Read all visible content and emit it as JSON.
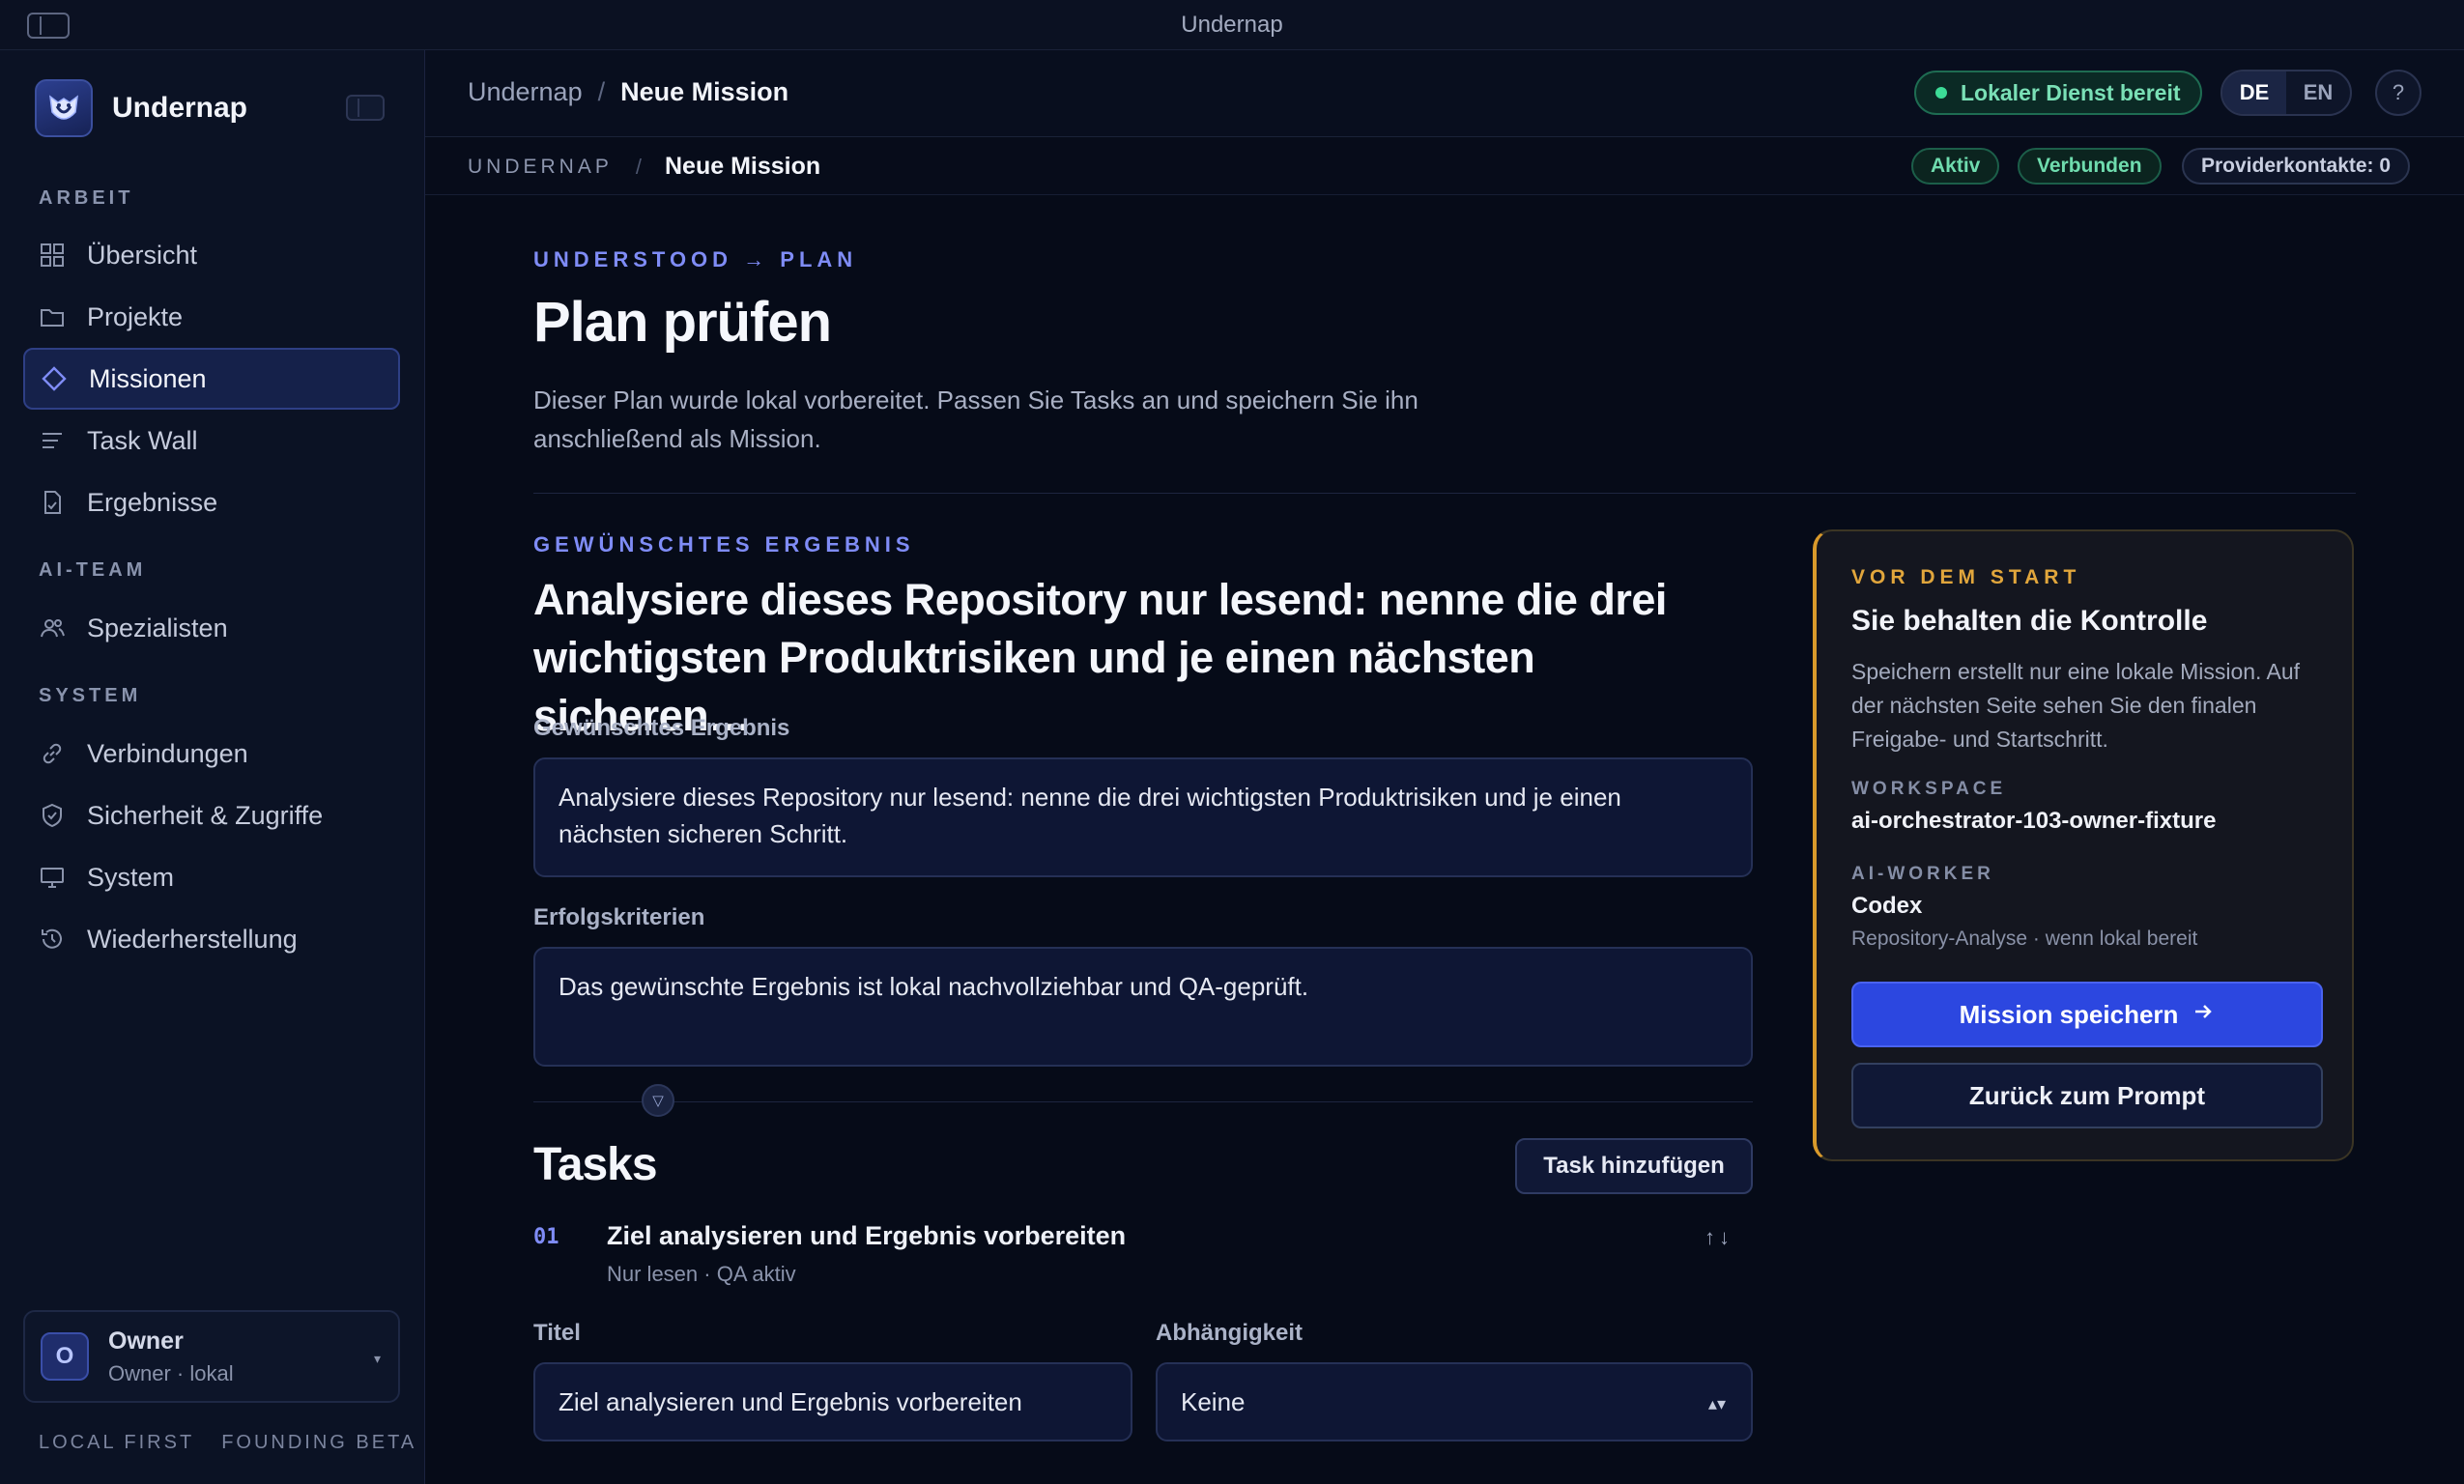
{
  "window": {
    "title": "Undernap"
  },
  "sidebar": {
    "brand": "Undernap",
    "sections": [
      {
        "label": "ARBEIT"
      },
      {
        "label": "AI-TEAM"
      },
      {
        "label": "SYSTEM"
      }
    ],
    "items": [
      {
        "label": "Übersicht",
        "icon": "grid-icon"
      },
      {
        "label": "Projekte",
        "icon": "folder-icon"
      },
      {
        "label": "Missionen",
        "icon": "diamond-icon",
        "active": true
      },
      {
        "label": "Task Wall",
        "icon": "lines-icon"
      },
      {
        "label": "Ergebnisse",
        "icon": "document-icon"
      },
      {
        "label": "Spezialisten",
        "icon": "users-icon"
      },
      {
        "label": "Verbindungen",
        "icon": "link-icon"
      },
      {
        "label": "Sicherheit & Zugriffe",
        "icon": "shield-icon"
      },
      {
        "label": "System",
        "icon": "monitor-icon"
      },
      {
        "label": "Wiederherstellung",
        "icon": "history-icon"
      }
    ],
    "owner": {
      "initial": "O",
      "name": "Owner",
      "sub": "Owner · lokal"
    },
    "footer": [
      "LOCAL FIRST",
      "FOUNDING BETA"
    ]
  },
  "header": {
    "crumb_root": "Undernap",
    "crumb_sep": "/",
    "crumb_current": "Neue Mission",
    "status": "Lokaler Dienst bereit",
    "lang": [
      "DE",
      "EN"
    ],
    "lang_active": "DE",
    "help": "?"
  },
  "subheader": {
    "crumb_root": "UNDERNAP",
    "crumb_sep": "/",
    "crumb_current": "Neue Mission",
    "badges": [
      "Aktiv",
      "Verbunden",
      "Providerkontakte: 0"
    ]
  },
  "main": {
    "eyebrow": "UNDERSTOOD → PLAN",
    "title": "Plan prüfen",
    "description": "Dieser Plan wurde lokal vorbereitet. Passen Sie Tasks an und speichern Sie ihn anschließend als Mission.",
    "goal_eyebrow": "GEWÜNSCHTES ERGEBNIS",
    "goal_title": "Analysiere dieses Repository nur lesend: nenne die drei wichtigsten Produktrisiken und je einen nächsten sicheren…",
    "result_label": "Gewünschtes Ergebnis",
    "result_value": "Analysiere dieses Repository nur lesend: nenne die drei wichtigsten Produktrisiken und je einen nächsten sicheren Schritt.",
    "criteria_label": "Erfolgskriterien",
    "criteria_value": "Das gewünschte Ergebnis ist lokal nachvollziehbar und QA-geprüft.",
    "tasks_title": "Tasks",
    "add_task": "Task hinzufügen",
    "task": {
      "number": "01",
      "title": "Ziel analysieren und Ergebnis vorbereiten",
      "sub": "Nur lesen · QA aktiv",
      "arrows": "↑↓",
      "title_label": "Titel",
      "title_value": "Ziel analysieren und Ergebnis vorbereiten",
      "dependency_label": "Abhängigkeit",
      "dependency_value": "Keine"
    }
  },
  "side_card": {
    "eyebrow": "VOR DEM START",
    "title": "Sie behalten die Kontrolle",
    "text": "Speichern erstellt nur eine lokale Mission. Auf der nächsten Seite sehen Sie den finalen Freigabe- und Startschritt.",
    "workspace_label": "WORKSPACE",
    "workspace_value": "ai-orchestrator-103-owner-fixture",
    "worker_label": "AI-WORKER",
    "worker_value": "Codex",
    "worker_note": "Repository-Analyse · wenn lokal bereit",
    "save_button": "Mission speichern",
    "back_button": "Zurück zum Prompt"
  },
  "colors": {
    "accent": "#2c47e0",
    "eyebrow": "#7f8cf6",
    "warning": "#d99a2b",
    "success": "#3ddc97",
    "background": "#060b18"
  }
}
